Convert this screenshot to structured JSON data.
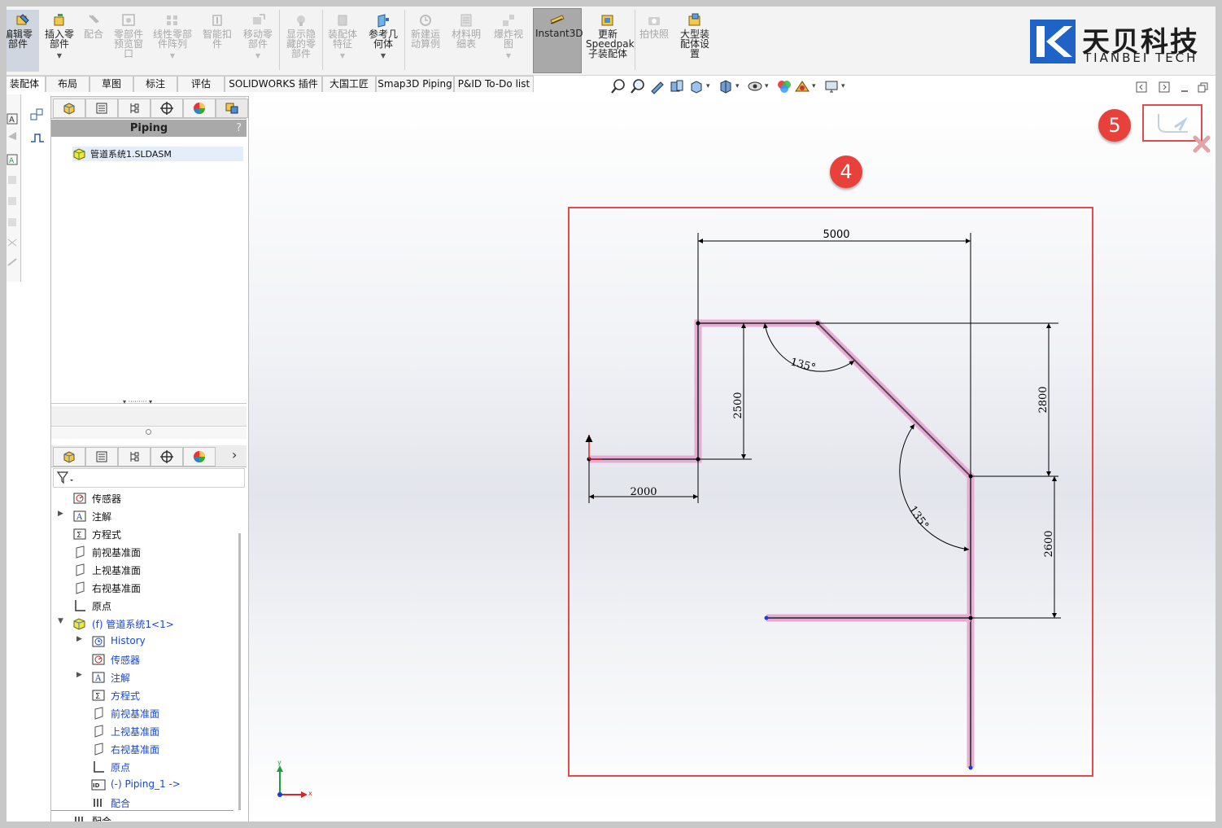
{
  "ribbon": {
    "buttons": [
      {
        "label": "编辑零部件",
        "state": "active-left"
      },
      {
        "label": "插入零部件",
        "state": "enabled"
      },
      {
        "label": "配合",
        "state": "disabled"
      },
      {
        "label": "零部件预览窗口",
        "state": "disabled"
      },
      {
        "label": "线性零部件阵列",
        "state": "disabled"
      },
      {
        "label": "智能扣件",
        "state": "disabled"
      },
      {
        "label": "移动零部件",
        "state": "disabled"
      },
      {
        "label": "显示隐藏的零部件",
        "state": "disabled"
      },
      {
        "label": "装配体特征",
        "state": "disabled"
      },
      {
        "label": "参考几何体",
        "state": "enabled"
      },
      {
        "label": "新建运动算例",
        "state": "disabled"
      },
      {
        "label": "材料明细表",
        "state": "disabled"
      },
      {
        "label": "爆炸视图",
        "state": "disabled"
      },
      {
        "label": "Instant3D",
        "state": "active"
      },
      {
        "label": "更新Speedpak子装配体",
        "state": "enabled"
      },
      {
        "label": "拍快照",
        "state": "disabled"
      },
      {
        "label": "大型装配体设置",
        "state": "enabled"
      }
    ]
  },
  "logo": {
    "cn": "天贝科技",
    "en": "TIANBEI TECH"
  },
  "tabs": [
    "装配体",
    "布局",
    "草图",
    "标注",
    "评估",
    "SOLIDWORKS 插件",
    "大国工匠",
    "Smap3D Piping",
    "P&ID To-Do list"
  ],
  "panel": {
    "header": "Piping",
    "help": "?",
    "top_item": "管道系统1.SLDASM",
    "tree": [
      {
        "text": "传感器",
        "indent": 0,
        "blue": false,
        "expander": false,
        "icon": "sensor-icon"
      },
      {
        "text": "注解",
        "indent": 0,
        "blue": false,
        "expander": true,
        "icon": "annotation-icon"
      },
      {
        "text": "方程式",
        "indent": 0,
        "blue": false,
        "expander": false,
        "icon": "equation-icon"
      },
      {
        "text": "前视基准面",
        "indent": 0,
        "blue": false,
        "expander": false,
        "icon": "plane-icon"
      },
      {
        "text": "上视基准面",
        "indent": 0,
        "blue": false,
        "expander": false,
        "icon": "plane-icon"
      },
      {
        "text": "右视基准面",
        "indent": 0,
        "blue": false,
        "expander": false,
        "icon": "plane-icon"
      },
      {
        "text": "原点",
        "indent": 0,
        "blue": false,
        "expander": false,
        "icon": "origin-icon"
      },
      {
        "text": "(f) 管道系统1<1>",
        "indent": 0,
        "blue": true,
        "expander": true,
        "expanded": true,
        "icon": "assembly-icon"
      },
      {
        "text": "History",
        "indent": 1,
        "blue": true,
        "expander": true,
        "icon": "history-icon"
      },
      {
        "text": "传感器",
        "indent": 1,
        "blue": true,
        "expander": false,
        "icon": "sensor-icon"
      },
      {
        "text": "注解",
        "indent": 1,
        "blue": true,
        "expander": true,
        "icon": "annotation-icon"
      },
      {
        "text": "方程式",
        "indent": 1,
        "blue": true,
        "expander": false,
        "icon": "equation-icon"
      },
      {
        "text": "前视基准面",
        "indent": 1,
        "blue": true,
        "expander": false,
        "icon": "plane-icon"
      },
      {
        "text": "上视基准面",
        "indent": 1,
        "blue": true,
        "expander": false,
        "icon": "plane-icon"
      },
      {
        "text": "右视基准面",
        "indent": 1,
        "blue": true,
        "expander": false,
        "icon": "plane-icon"
      },
      {
        "text": "原点",
        "indent": 1,
        "blue": true,
        "expander": false,
        "icon": "origin-icon"
      },
      {
        "text": "(-) Piping_1 ->",
        "indent": 1,
        "blue": true,
        "expander": false,
        "icon": "piping-part-icon"
      },
      {
        "text": "配合",
        "indent": 1,
        "blue": true,
        "expander": false,
        "icon": "mates-icon"
      },
      {
        "text": "配合",
        "indent": 0,
        "blue": false,
        "expander": false,
        "icon": "mates-icon"
      }
    ]
  },
  "drawing": {
    "dimensions": [
      "5000",
      "2800",
      "2500",
      "2000",
      "2600"
    ],
    "angles": [
      "135°",
      "135°"
    ]
  },
  "badges": [
    "4",
    "5"
  ],
  "triad": {
    "x": "x",
    "y": "y"
  },
  "colors": {
    "pipe": "#e6a9d3",
    "highlight": "#e54a4a",
    "active_tab": "#a9a9a9"
  }
}
